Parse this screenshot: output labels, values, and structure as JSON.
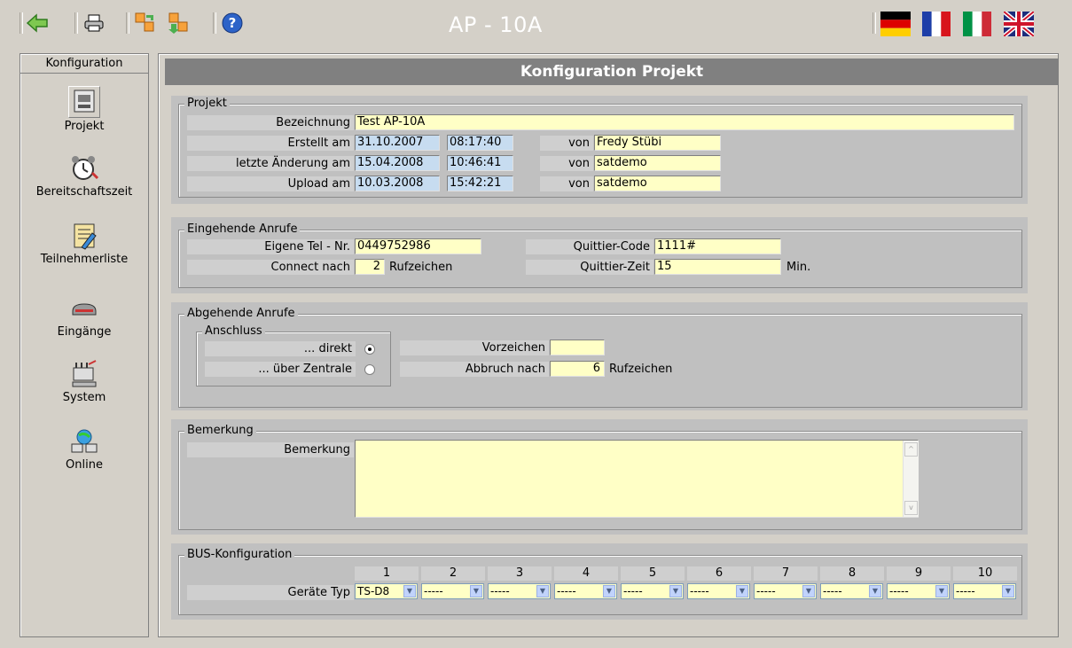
{
  "toolbar": {
    "title": "AP - 10A",
    "buttons": [
      "back-icon",
      "print-icon",
      "download-icon",
      "upload-icon",
      "help-icon"
    ],
    "flags": [
      "flag-de-icon",
      "flag-fr-icon",
      "flag-it-icon",
      "flag-uk-icon"
    ]
  },
  "sidebar": {
    "header": "Konfiguration",
    "items": [
      {
        "label": "Projekt",
        "icon": "computer-icon"
      },
      {
        "label": "Bereitschaftszeit",
        "icon": "alarm-clock-icon"
      },
      {
        "label": "Teilnehmerliste",
        "icon": "notepad-icon"
      },
      {
        "label": "Eingänge",
        "icon": "device-icon"
      },
      {
        "label": "System",
        "icon": "system-icon"
      },
      {
        "label": "Online",
        "icon": "network-icon"
      }
    ]
  },
  "main": {
    "title": "Konfiguration Projekt",
    "projekt": {
      "legend": "Projekt",
      "bezeichnung_label": "Bezeichnung",
      "bezeichnung": "Test AP-10A",
      "rows": [
        {
          "label": "Erstellt am",
          "date": "31.10.2007",
          "time": "08:17:40",
          "von_label": "von",
          "von": "Fredy Stübi"
        },
        {
          "label": "letzte Änderung am",
          "date": "15.04.2008",
          "time": "10:46:41",
          "von_label": "von",
          "von": "satdemo"
        },
        {
          "label": "Upload am",
          "date": "10.03.2008",
          "time": "15:42:21",
          "von_label": "von",
          "von": "satdemo"
        }
      ]
    },
    "eingehend": {
      "legend": "Eingehende Anrufe",
      "tel_label": "Eigene Tel - Nr.",
      "tel": "0449752986",
      "connect_label": "Connect nach",
      "connect": "2",
      "connect_unit": "Rufzeichen",
      "qcode_label": "Quittier-Code",
      "qcode": "1111#",
      "qzeit_label": "Quittier-Zeit",
      "qzeit": "15",
      "qzeit_unit": "Min."
    },
    "abgehend": {
      "legend": "Abgehende Anrufe",
      "anschluss_legend": "Anschluss",
      "direkt_label": "... direkt",
      "zentrale_label": "... über Zentrale",
      "vorzeichen_label": "Vorzeichen",
      "vorzeichen": "",
      "abbruch_label": "Abbruch nach",
      "abbruch": "6",
      "abbruch_unit": "Rufzeichen"
    },
    "bemerkung": {
      "legend": "Bemerkung",
      "label": "Bemerkung",
      "value": ""
    },
    "bus": {
      "legend": "BUS-Konfiguration",
      "label": "Geräte Typ",
      "columns": [
        "1",
        "2",
        "3",
        "4",
        "5",
        "6",
        "7",
        "8",
        "9",
        "10"
      ],
      "values": [
        "TS-D8",
        "-----",
        "-----",
        "-----",
        "-----",
        "-----",
        "-----",
        "-----",
        "-----",
        "-----"
      ]
    }
  }
}
